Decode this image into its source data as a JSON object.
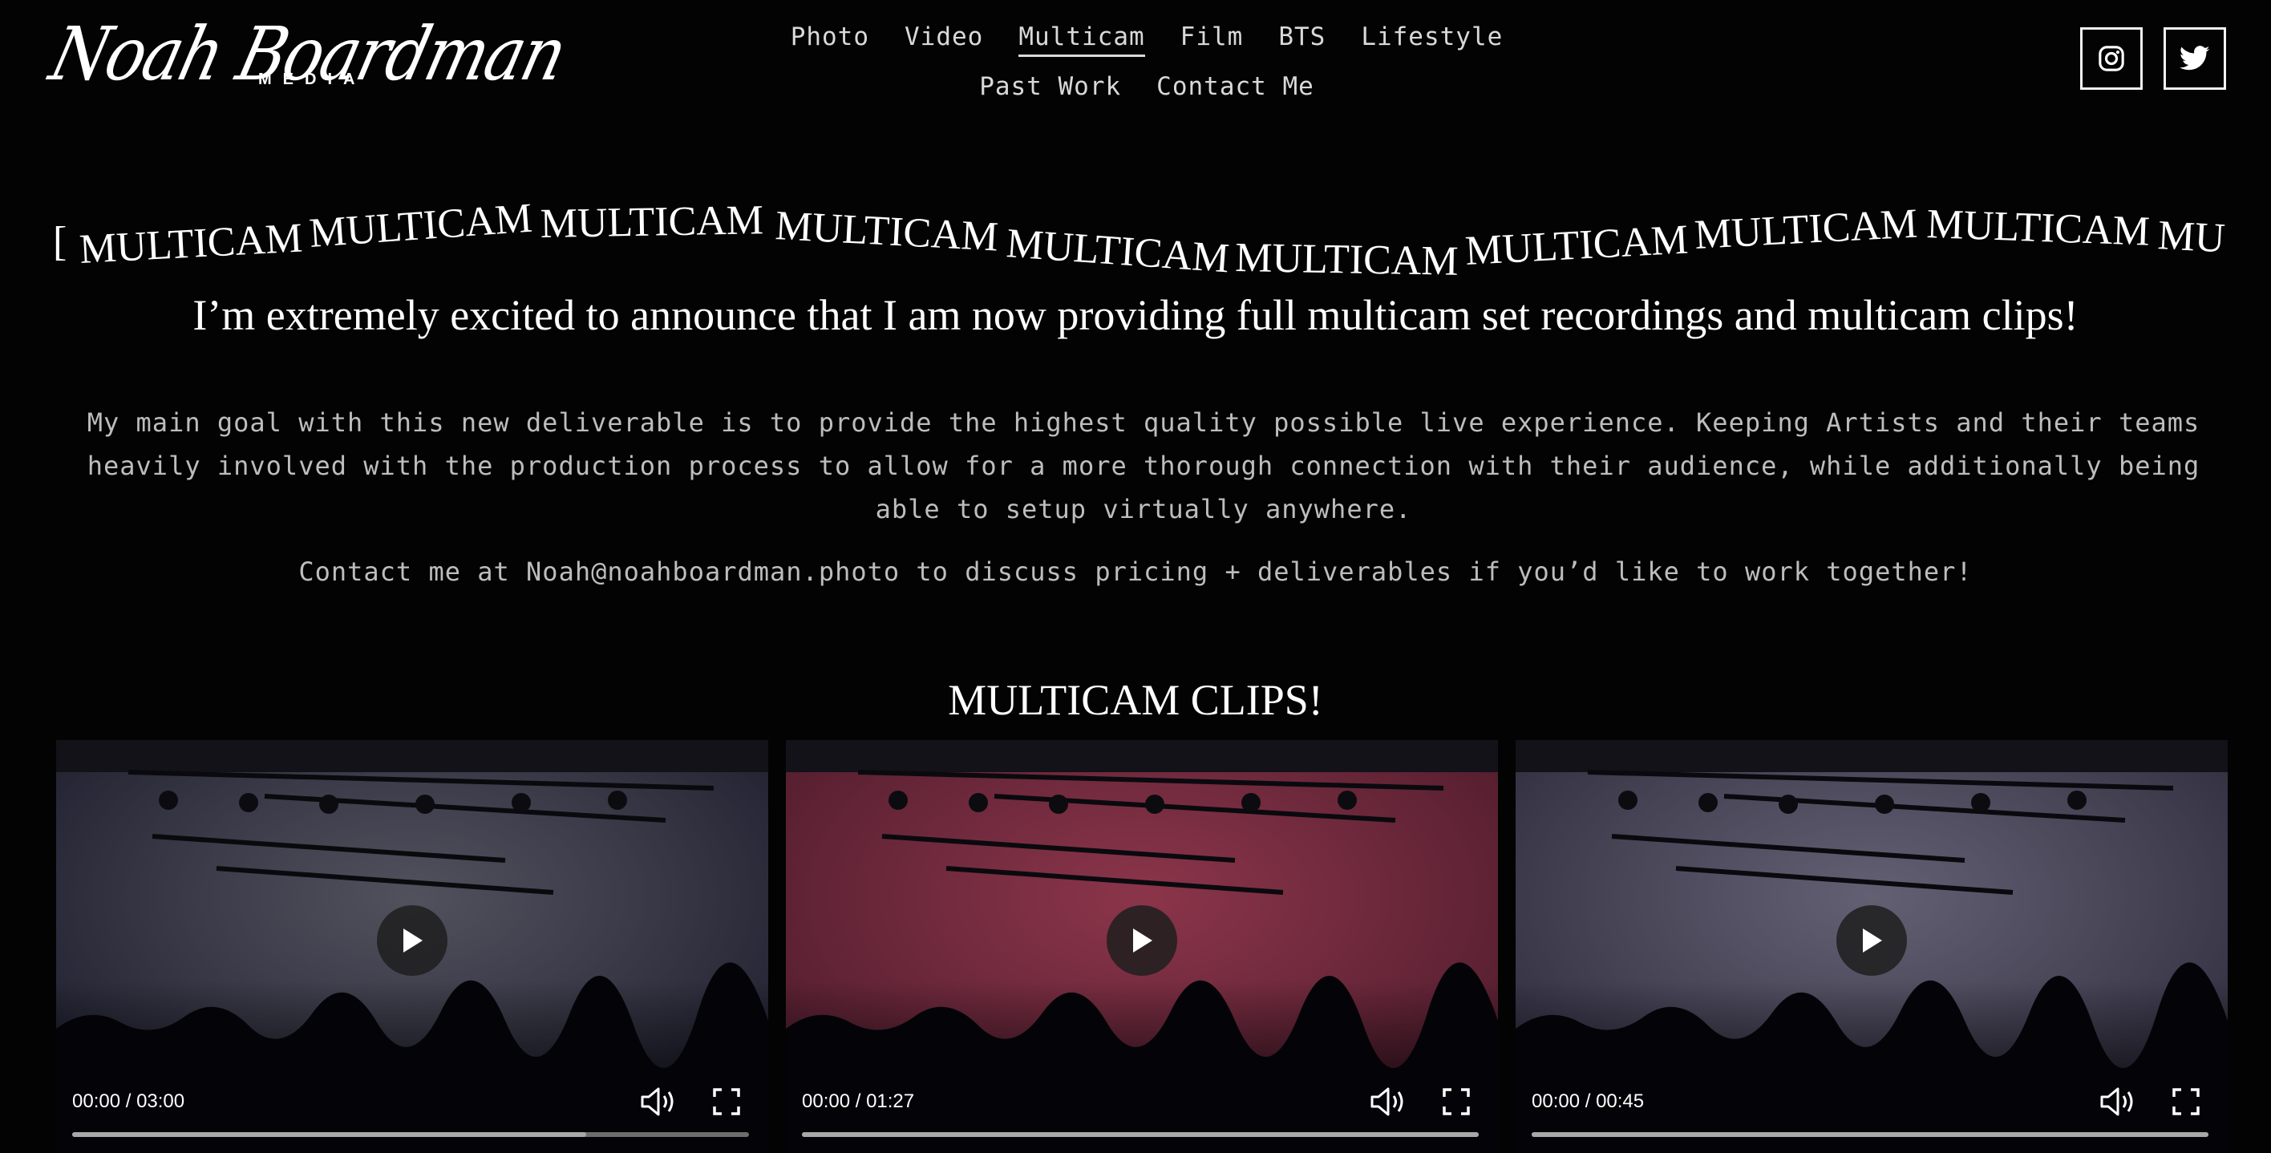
{
  "brand": {
    "script": "Noah Boardman",
    "sub": "MEDIA"
  },
  "nav": {
    "row1": [
      "Photo",
      "Video",
      "Multicam",
      "Film",
      "BTS",
      "Lifestyle"
    ],
    "row2": [
      "Past Work",
      "Contact Me"
    ],
    "active": "Multicam"
  },
  "social": {
    "instagram_icon": "instagram-icon",
    "twitter_icon": "twitter-icon"
  },
  "marquee": {
    "word": "MULTICAM",
    "lead_fragment": "[",
    "tail_fragment": "MU"
  },
  "announcement": "I’m extremely excited to announce that I am now providing full multicam set recordings and multicam clips!",
  "body": "My main goal with this new deliverable is to provide the highest quality possible live experience. Keeping Artists and their teams heavily involved with the production process to allow for a more thorough connection with their audience, while additionally being able to setup virtually anywhere.",
  "contact": "Contact me at Noah@noahboardman.photo to discuss pricing + deliverables if you’d like to work together!",
  "clips_heading": "MULTICAM CLIPS!",
  "videos": [
    {
      "time": "00:00 / 03:00",
      "progress": 0.76,
      "tint": "#1a1a2a",
      "haze": "#5a5a68"
    },
    {
      "time": "00:00 / 01:27",
      "progress": 1.0,
      "tint": "#4a1a2a",
      "haze": "#9a3a52"
    },
    {
      "time": "00:00 / 00:45",
      "progress": 1.0,
      "tint": "#2a2838",
      "haze": "#6e6a80"
    }
  ]
}
